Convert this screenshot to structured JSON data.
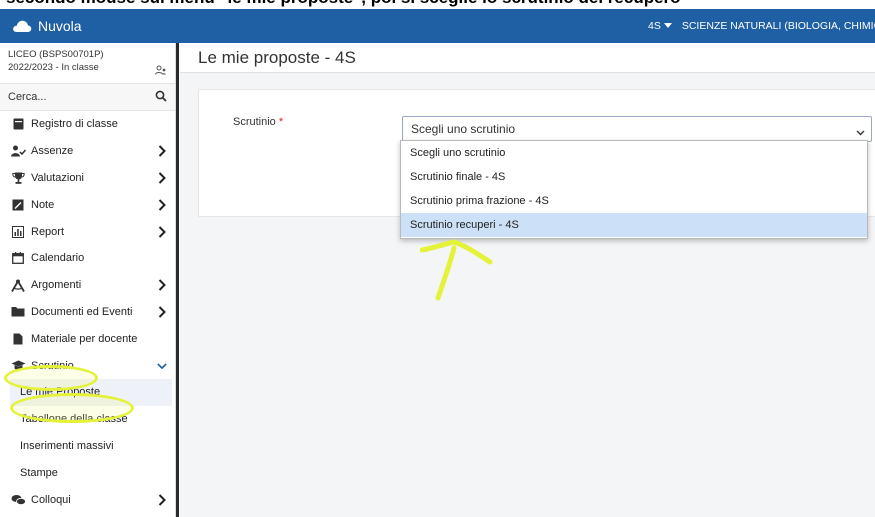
{
  "caption": "secondo mouse sul menu \"le mie proposte\", poi si sceglie lo scrutinio del recupero",
  "app": {
    "brand": "Nuvola"
  },
  "topbar": {
    "class_label": "4S",
    "subject": "SCIENZE NATURALI (BIOLOGIA, CHIMICA, S"
  },
  "sidebar": {
    "school": "LICEO (BSPS00701P)",
    "year": "2022/2023 - In classe",
    "search_placeholder": "Cerca...",
    "items": [
      {
        "label": "Registro di classe",
        "icon": "book-icon"
      },
      {
        "label": "Assenze",
        "icon": "user-check-icon"
      },
      {
        "label": "Valutazioni",
        "icon": "trophy-icon"
      },
      {
        "label": "Note",
        "icon": "note-icon"
      },
      {
        "label": "Report",
        "icon": "report-icon"
      },
      {
        "label": "Calendario",
        "icon": "calendar-icon"
      },
      {
        "label": "Argomenti",
        "icon": "compass-icon"
      },
      {
        "label": "Documenti ed Eventi",
        "icon": "folder-icon"
      },
      {
        "label": "Materiale per docente",
        "icon": "file-icon"
      },
      {
        "label": "Scrutinio",
        "icon": "graduation-cap-icon"
      }
    ],
    "subitems": [
      {
        "label": "Le mie Proposte"
      },
      {
        "label": "Tabellone della classe"
      },
      {
        "label": "Inserimenti massivi"
      },
      {
        "label": "Stampe"
      }
    ],
    "last_item": {
      "label": "Colloqui",
      "icon": "chat-icon"
    }
  },
  "main": {
    "page_title": "Le mie proposte - 4S",
    "field_label": "Scrutinio",
    "required_mark": "*",
    "select_value": "Scegli uno scrutinio",
    "options": [
      "Scegli uno scrutinio",
      "Scrutinio finale - 4S",
      "Scrutinio prima frazione - 4S",
      "Scrutinio recuperi - 4S"
    ],
    "selected_option": "Scrutinio recuperi - 4S"
  },
  "colors": {
    "topbar": "#1f5fa3",
    "highlight": "#e4f23a",
    "option_hover": "#cce0f7"
  }
}
